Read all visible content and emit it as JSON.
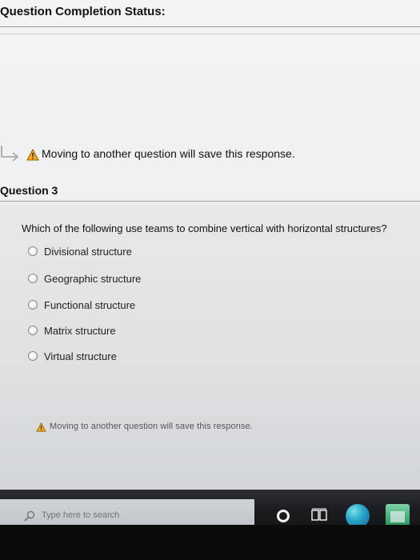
{
  "status": {
    "title": "Question Completion Status:"
  },
  "warnings": {
    "top": "Moving to another question will save this response.",
    "bottom": "Moving to another question will save this response."
  },
  "question": {
    "label": "Question 3",
    "text": "Which of the following use teams to combine vertical with horizontal structures?",
    "options": [
      "Divisional structure",
      "Geographic structure",
      "Functional structure",
      "Matrix structure",
      "Virtual structure"
    ]
  },
  "taskbar": {
    "search_placeholder": "Type here to search",
    "icons": [
      "search-icon",
      "cortana-icon",
      "task-view-icon",
      "edge-icon",
      "store-icon"
    ]
  },
  "colors": {
    "warning": "#f2b01e",
    "warning_outline": "#9a5a00",
    "taskbar": "#111214",
    "edge": "#2aa7c9",
    "store": "#1f8f5a"
  }
}
